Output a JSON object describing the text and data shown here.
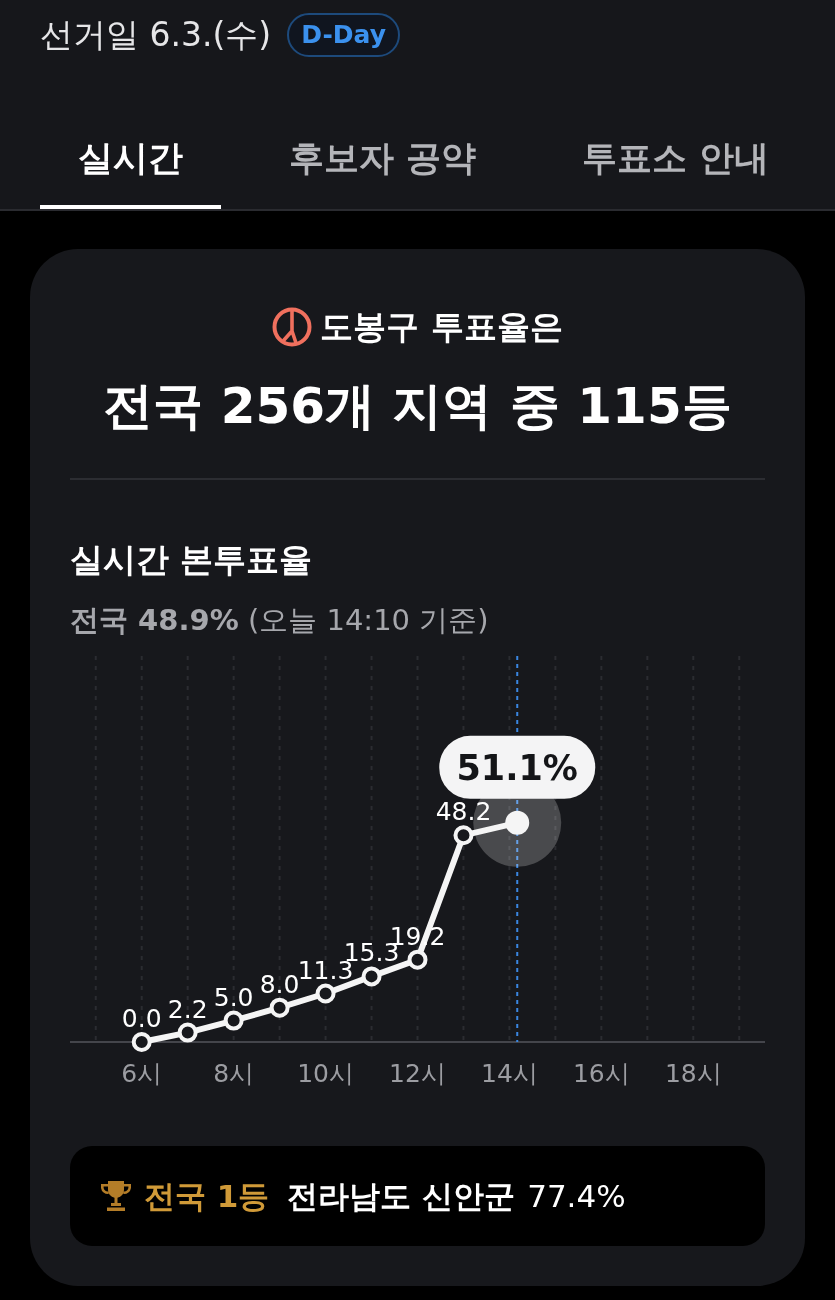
{
  "header": {
    "title": "선거일 6.3.(수)",
    "badge": "D-Day"
  },
  "tabs": [
    {
      "label": "실시간",
      "selected": true
    },
    {
      "label": "후보자 공약",
      "selected": false
    },
    {
      "label": "투표소 안내",
      "selected": false
    }
  ],
  "turnout": {
    "region_line": "도봉구 투표율은",
    "rank_line": "전국 256개 지역 중 115등"
  },
  "live_turnout": {
    "title": "실시간 본투표율",
    "summary": "**전국 48.9%** (오늘 14:10 기준)",
    "chart_data": {
      "type": "line",
      "x": [
        6,
        7,
        8,
        9,
        10,
        11,
        12,
        13,
        14.17
      ],
      "values": [
        0.0,
        2.2,
        5.0,
        8.0,
        11.3,
        15.3,
        19.2,
        48.2,
        51.1
      ],
      "xlim": [
        4.44,
        19.56
      ],
      "ylim": [
        0,
        90
      ],
      "xticks": [
        {
          "value": 6,
          "label": "6시"
        },
        {
          "value": 8,
          "label": "8시"
        },
        {
          "value": 10,
          "label": "10시"
        },
        {
          "value": 12,
          "label": "12시"
        },
        {
          "value": 14,
          "label": "14시"
        },
        {
          "value": 16,
          "label": "16시"
        },
        {
          "value": 18,
          "label": "18시"
        }
      ],
      "grid": "x",
      "marker": "o",
      "value_labels": [
        "0.0",
        "2.2",
        "5.0",
        "8.0",
        "11.3",
        "15.3",
        "19.2",
        "48.2",
        null
      ],
      "ref_lines": [
        {
          "axis": "x",
          "value": 14.17,
          "color": "#3a87e2"
        }
      ],
      "annotations": [
        {
          "text": "51.1%"
        }
      ]
    }
  },
  "top_region": {
    "label": "전국 1등",
    "region": "전라남도 신안군",
    "rate": "77.4%"
  }
}
